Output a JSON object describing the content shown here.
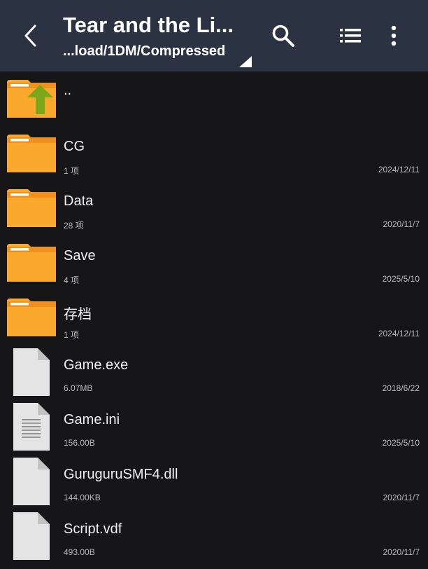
{
  "header": {
    "title": "Tear and the Li...",
    "path": "...load/1DM/Compressed",
    "icons": {
      "back": "back-arrow-icon",
      "search": "search-icon",
      "view": "list-view-icon",
      "more": "more-vert-icon"
    }
  },
  "files": [
    {
      "name": "..",
      "meta": "",
      "date": "",
      "icon": "folder-up-icon"
    },
    {
      "name": "CG",
      "meta": "1 项",
      "date": "2024/12/11",
      "icon": "folder-icon"
    },
    {
      "name": "Data",
      "meta": "28 项",
      "date": "2020/11/7",
      "icon": "folder-icon"
    },
    {
      "name": "Save",
      "meta": "4 项",
      "date": "2025/5/10",
      "icon": "folder-icon"
    },
    {
      "name": "存档",
      "meta": "1 项",
      "date": "2024/12/11",
      "icon": "folder-icon"
    },
    {
      "name": "Game.exe",
      "meta": "6.07MB",
      "date": "2018/6/22",
      "icon": "file-icon"
    },
    {
      "name": "Game.ini",
      "meta": "156.00B",
      "date": "2025/5/10",
      "icon": "text-file-icon"
    },
    {
      "name": "GuruguruSMF4.dll",
      "meta": "144.00KB",
      "date": "2020/11/7",
      "icon": "file-icon"
    },
    {
      "name": "Script.vdf",
      "meta": "493.00B",
      "date": "2020/11/7",
      "icon": "file-icon"
    }
  ],
  "colors": {
    "appbar": "#2b3342",
    "background": "#161618",
    "folder": "#fba92d",
    "folder_tab": "#f0901e",
    "up_arrow": "#7aa81a",
    "file": "#e4e4e4"
  }
}
